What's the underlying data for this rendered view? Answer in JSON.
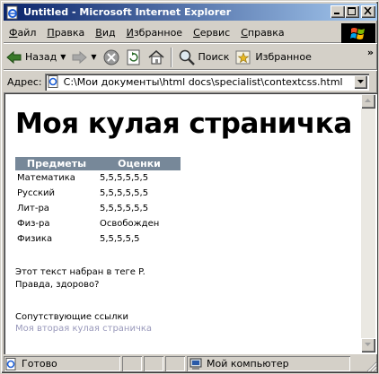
{
  "window": {
    "title": "Untitled - Microsoft Internet Explorer",
    "icon": "ie-page-icon",
    "controls": [
      "minimize-icon",
      "maximize-icon",
      "close-icon"
    ]
  },
  "menu": {
    "items": [
      {
        "label": "Файл",
        "hotkey": "Ф",
        "rest": "айл"
      },
      {
        "label": "Правка",
        "hotkey": "П",
        "rest": "равка"
      },
      {
        "label": "Вид",
        "hotkey": "В",
        "rest": "ид"
      },
      {
        "label": "Избранное",
        "hotkey": "И",
        "rest": "збранное"
      },
      {
        "label": "Сервис",
        "hotkey": "С",
        "rest": "ервис"
      },
      {
        "label": "Справка",
        "hotkey": "С",
        "rest": "правка"
      }
    ],
    "logo": "windows-logo-icon"
  },
  "toolbar": {
    "back_label": "Назад",
    "search_label": "Поиск",
    "favorites_label": "Избранное",
    "more": "»"
  },
  "address": {
    "label": "Адрес:",
    "url": "C:\\Мои документы\\html docs\\specialist\\contextcss.html"
  },
  "page": {
    "heading": "Моя кулая страничка",
    "table": {
      "headers": [
        "Предметы",
        "Оценки"
      ],
      "rows": [
        [
          "Математика",
          "5,5,5,5,5,5"
        ],
        [
          "Русский",
          "5,5,5,5,5,5"
        ],
        [
          "Лит-ра",
          "5,5,5,5,5,5"
        ],
        [
          "Физ-ра",
          "Освобожден"
        ],
        [
          "Физика",
          "5,5,5,5,5"
        ]
      ]
    },
    "paragraph_line1": "Этот текст набран в теге P.",
    "paragraph_line2": "Правда, здорово?",
    "links_heading": "Сопутствующие ссылки",
    "link_text": "Моя вторая кулая страничка"
  },
  "status": {
    "text": "Готово",
    "zone": "Мой компьютер"
  },
  "colors": {
    "title_gradient_start": "#0a246a",
    "title_gradient_end": "#a6caf0",
    "table_header_bg": "#778899",
    "link": "#9999bb"
  }
}
